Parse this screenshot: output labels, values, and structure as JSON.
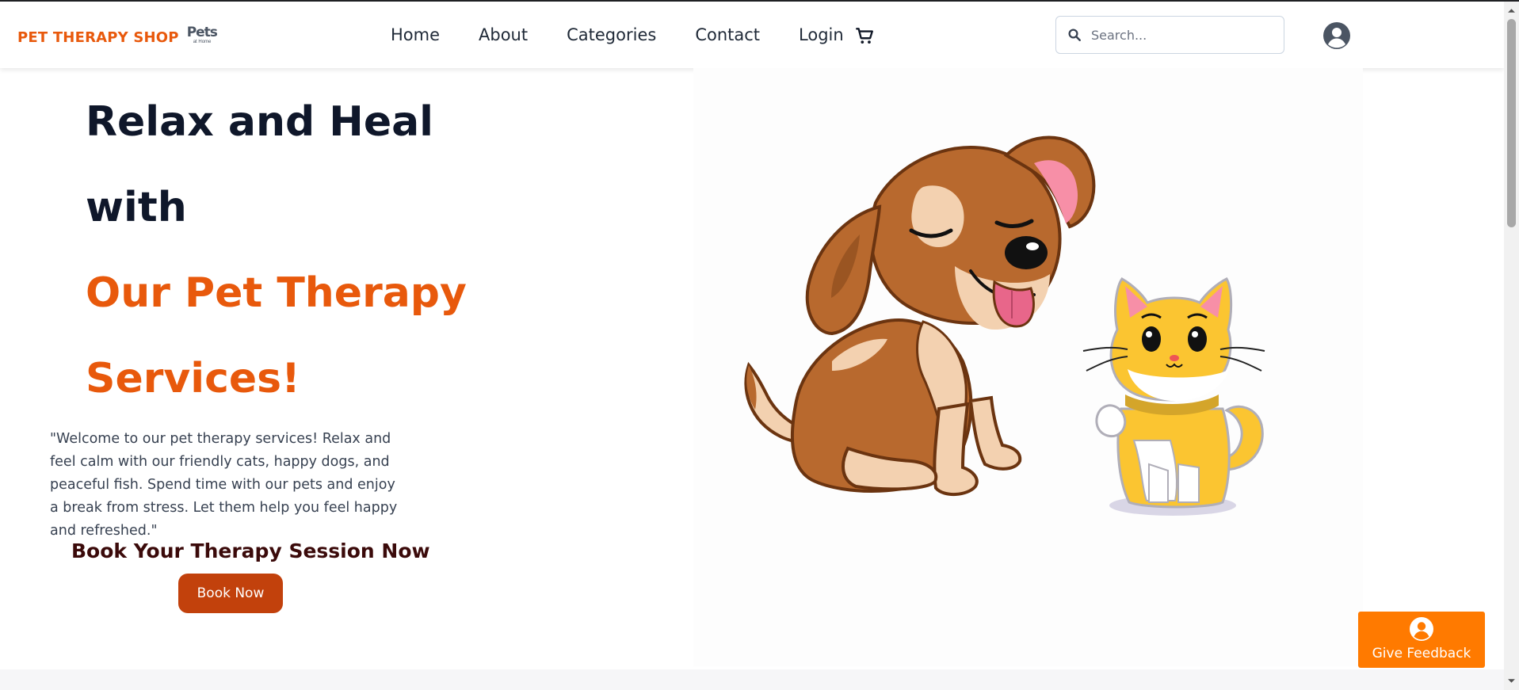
{
  "brand": {
    "name": "PET THERAPY SHOP",
    "logo_text": "Pets",
    "logo_subtext": "at Home"
  },
  "nav": {
    "items": [
      "Home",
      "About",
      "Categories",
      "Contact",
      "Login"
    ]
  },
  "icons": {
    "cart": "cart-icon",
    "search": "search-icon",
    "avatar": "user-circle-icon",
    "feedback": "user-circle-icon"
  },
  "search": {
    "placeholder": "Search...",
    "value": ""
  },
  "hero": {
    "title_line1": "Relax and Heal",
    "title_line2": "with",
    "title_line3": "Our Pet Therapy",
    "title_line4": "Services!",
    "intro": "\"Welcome to our pet therapy services! Relax and feel calm with our friendly cats, happy dogs, and peaceful fish. Spend time with our pets and enjoy a break from stress. Let them help you feel happy and refreshed.\"",
    "book_heading": "Book Your Therapy Session Now",
    "book_button": "Book Now"
  },
  "feedback": {
    "label": "Give Feedback"
  },
  "colors": {
    "accent": "#e8590c",
    "button": "#c2410c",
    "feedback": "#ff7a00",
    "heading": "#0f172a"
  }
}
